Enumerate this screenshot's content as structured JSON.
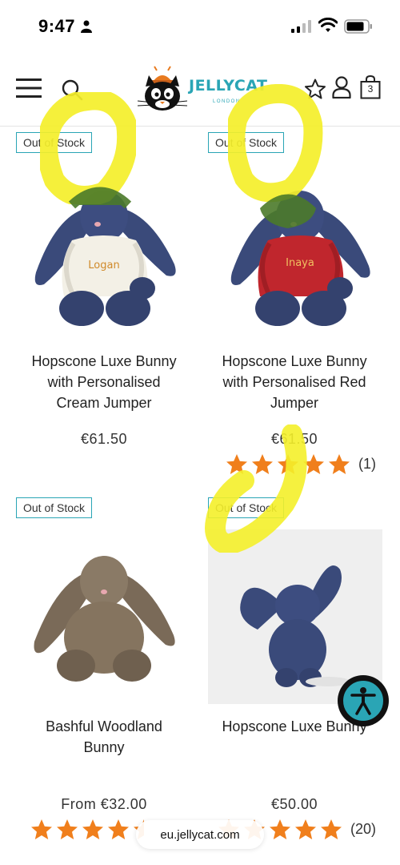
{
  "status_bar": {
    "time": "9:47",
    "icons": [
      "person-icon",
      "cellular-signal-icon",
      "wifi-icon",
      "battery-icon"
    ]
  },
  "header": {
    "logo_text": "JELLYCAT",
    "logo_subtext": "LONDON",
    "cart_count": "3",
    "icons": [
      "menu-icon",
      "search-icon",
      "wishlist-star-icon",
      "account-icon",
      "cart-icon"
    ]
  },
  "products": [
    {
      "badge": "Out of Stock",
      "name_lines": [
        "Hopscone Luxe Bunny",
        "with Personalised",
        "Cream Jumper"
      ],
      "jumper_text": "Logan",
      "price": "€61.50"
    },
    {
      "badge": "Out of Stock",
      "name_lines": [
        "Hopscone Luxe Bunny",
        "with Personalised Red",
        "Jumper"
      ],
      "jumper_text": "Inaya",
      "price": "€61.50",
      "rating": {
        "stars": 5,
        "count": "(1)"
      }
    },
    {
      "badge": "Out of Stock",
      "name_lines": [
        "Bashful Woodland",
        "Bunny"
      ],
      "price": "From €32.00",
      "rating": {
        "stars": 4.5
      }
    },
    {
      "badge": "Out of Stock",
      "name_lines": [
        "Hopscone Luxe Bunny"
      ],
      "price": "€50.00",
      "rating": {
        "stars": 5,
        "count": "(20)"
      }
    }
  ],
  "browser": {
    "url": "eu.jellycat.com"
  },
  "colors": {
    "accent": "#2aa5b5",
    "star": "#f07f1c",
    "highlighter": "#f4ef2a",
    "bunny_blue": "#3a4a7a"
  }
}
